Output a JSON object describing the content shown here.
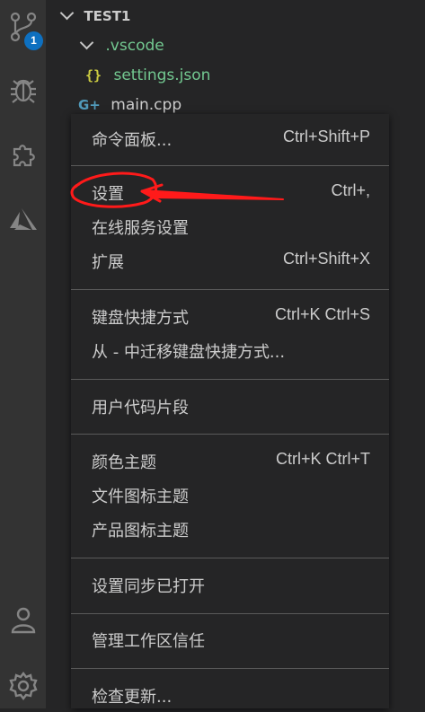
{
  "activity_bar": {
    "icons": [
      {
        "name": "source-control-icon"
      },
      {
        "name": "debug-icon"
      },
      {
        "name": "extensions-icon"
      },
      {
        "name": "azure-icon"
      },
      {
        "name": "account-icon"
      },
      {
        "name": "manage-gear-icon"
      }
    ],
    "source_control_badge": "1"
  },
  "explorer": {
    "workspace_title": "TEST1",
    "folder_name": ".vscode",
    "json_icon_glyph": "{}",
    "settings_file": "settings.json",
    "cpp_icon_glyph": "G+",
    "main_file": "main.cpp"
  },
  "menu": {
    "items": [
      {
        "label": "命令面板...",
        "shortcut": "Ctrl+Shift+P"
      },
      {
        "label": "设置",
        "shortcut": "Ctrl+,"
      },
      {
        "label": "在线服务设置",
        "shortcut": ""
      },
      {
        "label": "扩展",
        "shortcut": "Ctrl+Shift+X"
      },
      {
        "label": "键盘快捷方式",
        "shortcut": "Ctrl+K Ctrl+S"
      },
      {
        "label": "从 - 中迁移键盘快捷方式...",
        "shortcut": ""
      },
      {
        "label": "用户代码片段",
        "shortcut": ""
      },
      {
        "label": "颜色主题",
        "shortcut": "Ctrl+K Ctrl+T"
      },
      {
        "label": "文件图标主题",
        "shortcut": ""
      },
      {
        "label": "产品图标主题",
        "shortcut": ""
      },
      {
        "label": "设置同步已打开",
        "shortcut": ""
      },
      {
        "label": "管理工作区信任",
        "shortcut": ""
      },
      {
        "label": "检查更新...",
        "shortcut": ""
      }
    ]
  },
  "colors": {
    "activity_bar": "#333333",
    "sidebar": "#252526",
    "badge": "#0e70c0",
    "annotation": "#ff1a1a",
    "folder_text": "#73c991"
  }
}
